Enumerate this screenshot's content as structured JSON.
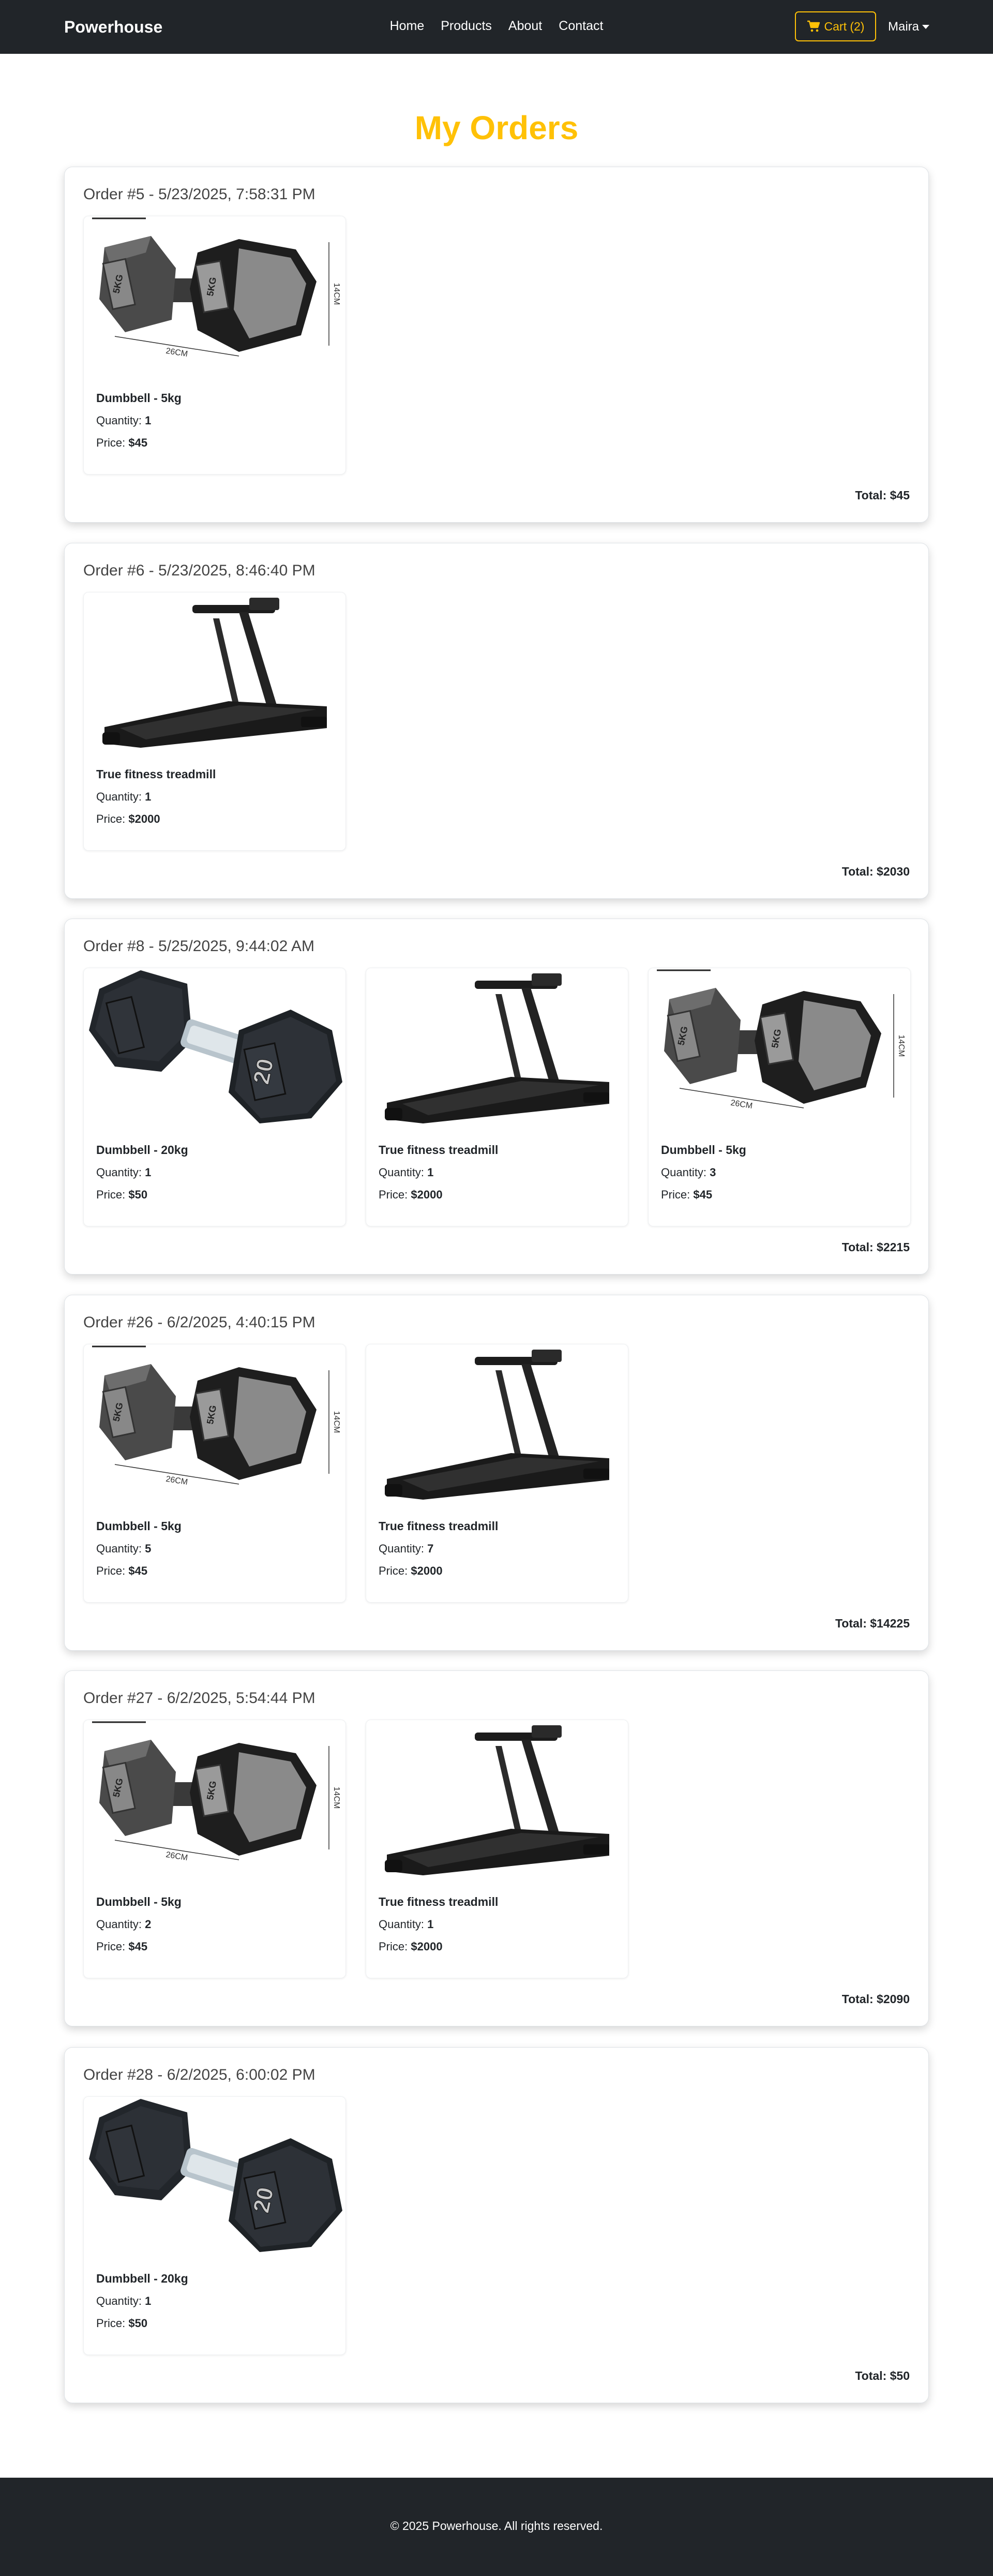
{
  "navbar": {
    "brand": "Powerhouse",
    "links": [
      "Home",
      "Products",
      "About",
      "Contact"
    ],
    "cart_label": "Cart (2)",
    "user": "Maira"
  },
  "page": {
    "title": "My Orders"
  },
  "orders": [
    {
      "heading": "Order #5 - 5/23/2025, 7:58:31 PM",
      "items": [
        {
          "name": "Dumbbell - 5kg",
          "qty_label": "Quantity:",
          "qty": "1",
          "price_label": "Price:",
          "price": "$45",
          "image": "dumbbell-5kg"
        }
      ],
      "total": "Total: $45"
    },
    {
      "heading": "Order #6 - 5/23/2025, 8:46:40 PM",
      "items": [
        {
          "name": "True fitness treadmill",
          "qty_label": "Quantity:",
          "qty": "1",
          "price_label": "Price:",
          "price": "$2000",
          "image": "treadmill"
        }
      ],
      "total": "Total: $2030"
    },
    {
      "heading": "Order #8 - 5/25/2025, 9:44:02 AM",
      "items": [
        {
          "name": "Dumbbell - 20kg",
          "qty_label": "Quantity:",
          "qty": "1",
          "price_label": "Price:",
          "price": "$50",
          "image": "dumbbell-20kg"
        },
        {
          "name": "True fitness treadmill",
          "qty_label": "Quantity:",
          "qty": "1",
          "price_label": "Price:",
          "price": "$2000",
          "image": "treadmill"
        },
        {
          "name": "Dumbbell - 5kg",
          "qty_label": "Quantity:",
          "qty": "3",
          "price_label": "Price:",
          "price": "$45",
          "image": "dumbbell-5kg"
        }
      ],
      "total": "Total: $2215"
    },
    {
      "heading": "Order #26 - 6/2/2025, 4:40:15 PM",
      "items": [
        {
          "name": "Dumbbell - 5kg",
          "qty_label": "Quantity:",
          "qty": "5",
          "price_label": "Price:",
          "price": "$45",
          "image": "dumbbell-5kg"
        },
        {
          "name": "True fitness treadmill",
          "qty_label": "Quantity:",
          "qty": "7",
          "price_label": "Price:",
          "price": "$2000",
          "image": "treadmill"
        }
      ],
      "total": "Total: $14225"
    },
    {
      "heading": "Order #27 - 6/2/2025, 5:54:44 PM",
      "items": [
        {
          "name": "Dumbbell - 5kg",
          "qty_label": "Quantity:",
          "qty": "2",
          "price_label": "Price:",
          "price": "$45",
          "image": "dumbbell-5kg"
        },
        {
          "name": "True fitness treadmill",
          "qty_label": "Quantity:",
          "qty": "1",
          "price_label": "Price:",
          "price": "$2000",
          "image": "treadmill"
        }
      ],
      "total": "Total: $2090"
    },
    {
      "heading": "Order #28 - 6/2/2025, 6:00:02 PM",
      "items": [
        {
          "name": "Dumbbell - 20kg",
          "qty_label": "Quantity:",
          "qty": "1",
          "price_label": "Price:",
          "price": "$50",
          "image": "dumbbell-20kg"
        }
      ],
      "total": "Total: $50"
    }
  ],
  "image_labels": {
    "length": "26CM",
    "height": "14CM",
    "weight_5": "5KG",
    "weight_20": "20"
  },
  "footer": {
    "text": "© 2025 Powerhouse. All rights reserved."
  },
  "colors": {
    "accent": "#ffc107",
    "navbar": "#212529"
  },
  "icons": {
    "cart": "cart-icon",
    "caret": "chevron-down-icon"
  }
}
